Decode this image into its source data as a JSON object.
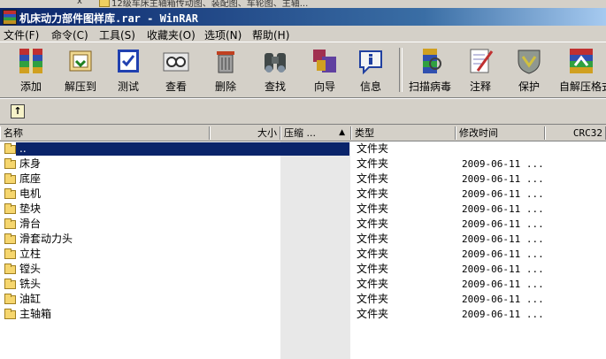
{
  "top_strip": {
    "close_glyph": "x",
    "text": "12级车床主轴箱传动图、装配图、车轮图、主轴..."
  },
  "window": {
    "title": "机床动力部件图样库.rar - WinRAR"
  },
  "menu": [
    "文件(F)",
    "命令(C)",
    "工具(S)",
    "收藏夹(O)",
    "选项(N)",
    "帮助(H)"
  ],
  "toolbar": [
    {
      "label": "添加",
      "icon": "add-icon"
    },
    {
      "label": "解压到",
      "icon": "extract-to-icon"
    },
    {
      "label": "测试",
      "icon": "test-icon"
    },
    {
      "label": "查看",
      "icon": "view-icon"
    },
    {
      "label": "删除",
      "icon": "delete-icon"
    },
    {
      "label": "查找",
      "icon": "find-icon"
    },
    {
      "label": "向导",
      "icon": "wizard-icon"
    },
    {
      "label": "信息",
      "icon": "info-icon"
    },
    {
      "label": "扫描病毒",
      "icon": "virus-scan-icon"
    },
    {
      "label": "注释",
      "icon": "comment-icon"
    },
    {
      "label": "保护",
      "icon": "protect-icon"
    },
    {
      "label": "自解压格式",
      "icon": "sfx-icon"
    }
  ],
  "address": {
    "up_icon": "up-folder-icon"
  },
  "columns": {
    "name": "名称",
    "size": "大小",
    "packed": "压缩 ...",
    "type": "类型",
    "modified": "修改时间",
    "crc": "CRC32"
  },
  "rows": [
    {
      "name": "..",
      "type": "文件夹",
      "modified": ""
    },
    {
      "name": "床身",
      "type": "文件夹",
      "modified": "2009-06-11 ..."
    },
    {
      "name": "底座",
      "type": "文件夹",
      "modified": "2009-06-11 ..."
    },
    {
      "name": "电机",
      "type": "文件夹",
      "modified": "2009-06-11 ..."
    },
    {
      "name": "垫块",
      "type": "文件夹",
      "modified": "2009-06-11 ..."
    },
    {
      "name": "滑台",
      "type": "文件夹",
      "modified": "2009-06-11 ..."
    },
    {
      "name": "滑套动力头",
      "type": "文件夹",
      "modified": "2009-06-11 ..."
    },
    {
      "name": "立柱",
      "type": "文件夹",
      "modified": "2009-06-11 ..."
    },
    {
      "name": "镗头",
      "type": "文件夹",
      "modified": "2009-06-11 ..."
    },
    {
      "name": "铣头",
      "type": "文件夹",
      "modified": "2009-06-11 ..."
    },
    {
      "name": "油缸",
      "type": "文件夹",
      "modified": "2009-06-11 ..."
    },
    {
      "name": "主轴箱",
      "type": "文件夹",
      "modified": "2009-06-11 ..."
    }
  ]
}
